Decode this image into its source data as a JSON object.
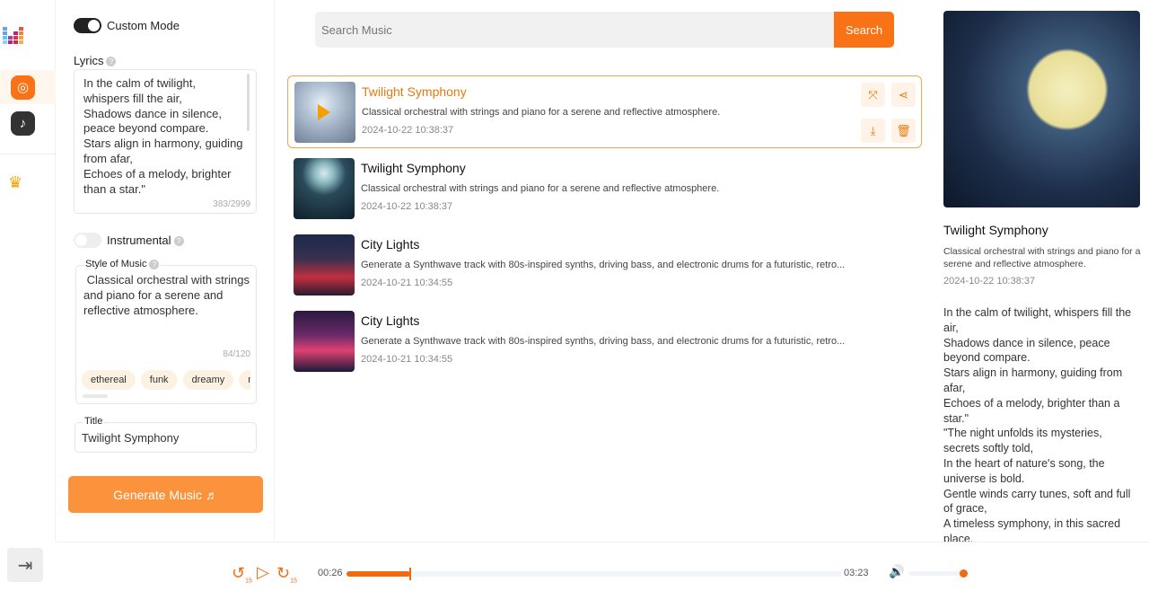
{
  "colors": {
    "accent": "#f97316",
    "accent_light": "#fb923c"
  },
  "rail": {
    "items": [
      {
        "icon": "music-disc-icon",
        "active": true
      },
      {
        "icon": "music-note-wave-icon",
        "active": false
      },
      {
        "icon": "crown-icon"
      }
    ],
    "exit_icon": "exit-icon"
  },
  "form": {
    "custom_mode": {
      "label": "Custom Mode",
      "on": true
    },
    "lyrics": {
      "label": "Lyrics",
      "value": "In the calm of twilight, whispers fill the air,\nShadows dance in silence, peace beyond compare.\nStars align in harmony, guiding from afar,\nEchoes of a melody, brighter than a star.\"",
      "count": "383/2999"
    },
    "instrumental": {
      "label": "Instrumental",
      "on": false
    },
    "style": {
      "label": "Style of Music",
      "value": " Classical orchestral with strings and piano for a serene and reflective atmosphere.",
      "count": "84/120",
      "tags": [
        "ethereal",
        "funk",
        "dreamy",
        "ma"
      ]
    },
    "title": {
      "label": "Title",
      "value": "Twilight Symphony"
    },
    "generate_label": "Generate Music ♬"
  },
  "search": {
    "placeholder": "Search Music",
    "button": "Search"
  },
  "songs": [
    {
      "title": "Twilight Symphony",
      "desc": "Classical orchestral with strings and piano for a serene and reflective atmosphere.",
      "date": "2024-10-22 10:38:37",
      "selected": true
    },
    {
      "title": "Twilight Symphony",
      "desc": "Classical orchestral with strings and piano for a serene and reflective atmosphere.",
      "date": "2024-10-22 10:38:37"
    },
    {
      "title": "City Lights",
      "desc": "Generate a Synthwave track with 80s-inspired synths, driving bass, and electronic drums for a futuristic, retro...",
      "date": "2024-10-21 10:34:55"
    },
    {
      "title": "City Lights",
      "desc": "Generate a Synthwave track with 80s-inspired synths, driving bass, and electronic drums for a futuristic, retro...",
      "date": "2024-10-21 10:34:55"
    }
  ],
  "detail": {
    "title": "Twilight Symphony",
    "desc": "Classical orchestral with strings and piano for a serene and reflective atmosphere.",
    "date": "2024-10-22 10:38:37",
    "lyrics": "In the calm of twilight, whispers fill the air,\nShadows dance in silence, peace beyond compare.\nStars align in harmony, guiding from afar,\nEchoes of a melody, brighter than a star.\"\n\"The night unfolds its mysteries, secrets softly told,\nIn the heart of nature's song, the universe is bold.\nGentle winds carry tunes, soft and full of grace,\nA timeless symphony, in this sacred place."
  },
  "player": {
    "current": "00:26",
    "duration": "03:23",
    "progress_percent": 12.8,
    "volume_percent": 100,
    "skip_back": "15",
    "skip_forward": "15"
  }
}
